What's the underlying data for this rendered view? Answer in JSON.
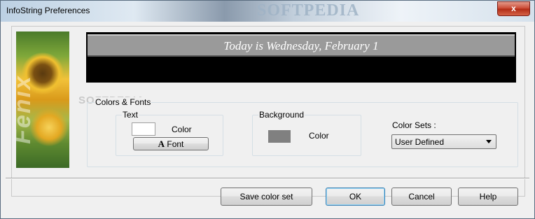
{
  "window": {
    "title": "InfoString Preferences",
    "watermark": "SOFTPEDIA",
    "close_glyph": "x"
  },
  "side_image": {
    "brand_text": "Fenix",
    "icon": "sunflower-image"
  },
  "preview": {
    "text": "Today is Wednesday, February 1"
  },
  "colors_fonts": {
    "label": "Colors & Fonts",
    "watermark": "SOFTPEDIA",
    "text_group": {
      "label": "Text",
      "swatch_color": "#ffffff",
      "color_label": "Color",
      "font_button_icon": "A",
      "font_button_label": "Font"
    },
    "background_group": {
      "label": "Background",
      "swatch_color": "#808080",
      "color_label": "Color"
    },
    "color_sets": {
      "label": "Color Sets :",
      "selected": "User Defined"
    }
  },
  "buttons": {
    "save_color_set": "Save color set",
    "ok": "OK",
    "cancel": "Cancel",
    "help": "Help"
  }
}
